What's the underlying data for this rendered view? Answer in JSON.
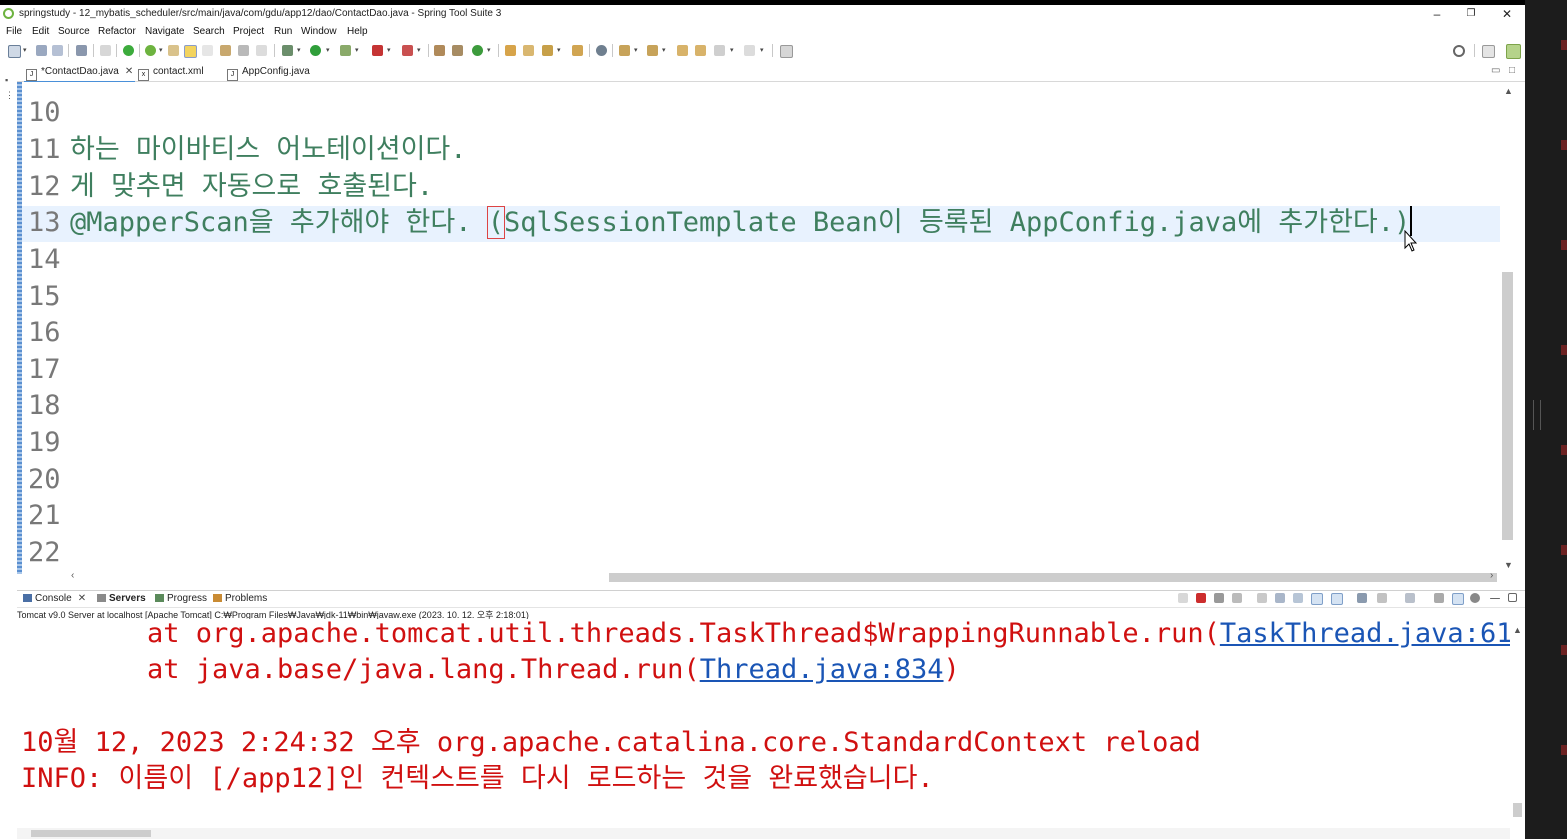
{
  "window": {
    "title": "springstudy - 12_mybatis_scheduler/src/main/java/com/gdu/app12/dao/ContactDao.java - Spring Tool Suite 3",
    "minimize": "–",
    "restore": "❐",
    "close": "✕"
  },
  "menu": [
    "File",
    "Edit",
    "Source",
    "Refactor",
    "Navigate",
    "Search",
    "Project",
    "Run",
    "Window",
    "Help"
  ],
  "editor_tabs": [
    {
      "label": "*ContactDao.java",
      "active": true,
      "closable": true,
      "icon": "J"
    },
    {
      "label": "contact.xml",
      "active": false,
      "closable": false,
      "icon": "x"
    },
    {
      "label": "AppConfig.java",
      "active": false,
      "closable": false,
      "icon": "J"
    }
  ],
  "editor": {
    "line_numbers": [
      "10",
      "11",
      "12",
      "13",
      "14",
      "15",
      "16",
      "17",
      "18",
      "19",
      "20",
      "21",
      "22"
    ],
    "line11": "하는 마이바티스 어노테이션이다.",
    "line12": "게 맞추면 자동으로 호출된다.",
    "line13_before": "@MapperScan을 추가해야 한다. ",
    "line13_paren": "(",
    "line13_after": "SqlSessionTemplate Bean이 등록된 AppConfig.java에 추가한다.)",
    "comment_color": "#3f7f5f"
  },
  "console_panel": {
    "tabs": [
      {
        "label": "Console",
        "closable": true
      },
      {
        "label": "Servers",
        "bold": true
      },
      {
        "label": "Progress"
      },
      {
        "label": "Problems"
      }
    ],
    "status": "Tomcat v9.0 Server at localhost [Apache Tomcat] C:₩Program Files₩Java₩jdk-11₩bin₩javaw.exe  (2023. 10. 12. 오후 2:18:01)",
    "lines": {
      "l1_prefix": "at org.apache.tomcat.util.threads.TaskThread$WrappingRunnable.run(",
      "l1_link": "TaskThread.java:61",
      "l1_suffix": ")",
      "l2_prefix": "at java.base/java.lang.Thread.run(",
      "l2_link": "Thread.java:834",
      "l2_suffix": ")",
      "l3": "10월 12, 2023 2:24:32 오후 org.apache.catalina.core.StandardContext reload",
      "l4": "INFO: 이름이 [/app12]인 컨텍스트를 다시 로드하는 것을 완료했습니다."
    },
    "error_color": "#d01010",
    "link_color": "#1a55b5"
  }
}
